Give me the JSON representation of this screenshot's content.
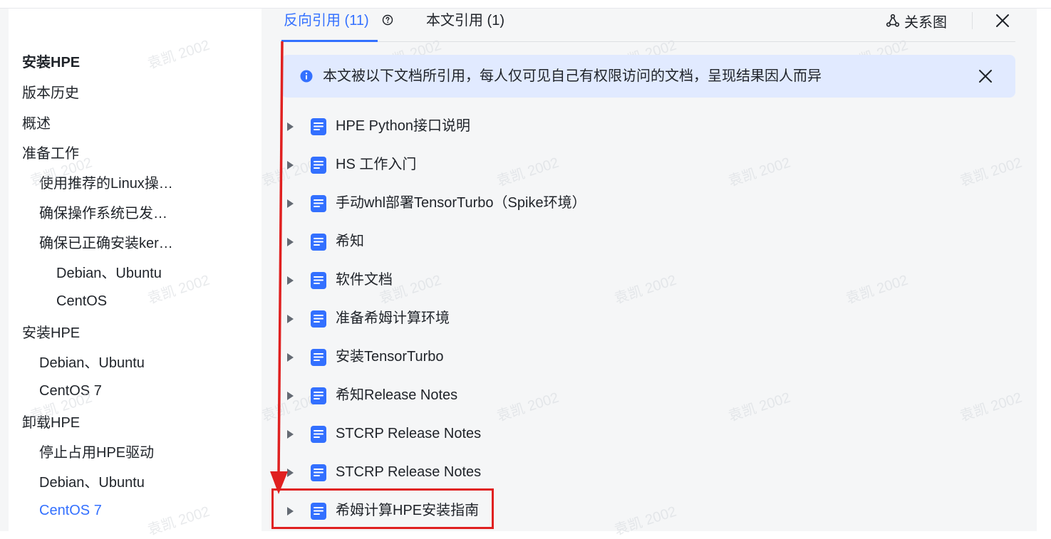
{
  "toc": {
    "items": [
      {
        "label": "安装HPE",
        "level": 0,
        "bold": true
      },
      {
        "label": "版本历史",
        "level": 0
      },
      {
        "label": "概述",
        "level": 0
      },
      {
        "label": "准备工作",
        "level": 0
      },
      {
        "label": "使用推荐的Linux操…",
        "level": 1
      },
      {
        "label": "确保操作系统已发…",
        "level": 1
      },
      {
        "label": "确保已正确安装ker…",
        "level": 1
      },
      {
        "label": "Debian、Ubuntu",
        "level": 2
      },
      {
        "label": "CentOS",
        "level": 2
      },
      {
        "label": "安装HPE",
        "level": 0
      },
      {
        "label": "Debian、Ubuntu",
        "level": 1
      },
      {
        "label": "CentOS 7",
        "level": 1
      },
      {
        "label": "卸载HPE",
        "level": 0
      },
      {
        "label": "停止占用HPE驱动",
        "level": 1
      },
      {
        "label": "Debian、Ubuntu",
        "level": 1
      },
      {
        "label": "CentOS 7",
        "level": 1,
        "active": true
      }
    ]
  },
  "panel": {
    "tabs": [
      {
        "label": "反向引用 (11)",
        "active": true
      },
      {
        "label": "本文引用 (1)",
        "active": false
      }
    ],
    "graph_label": "关系图",
    "banner_text": "本文被以下文档所引用，每人仅可见自己有权限访问的文档，呈现结果因人而异",
    "docs": [
      {
        "title": "HPE Python接口说明"
      },
      {
        "title": "HS 工作入门"
      },
      {
        "title": "手动whl部署TensorTurbo（Spike环境）"
      },
      {
        "title": "希知"
      },
      {
        "title": "软件文档"
      },
      {
        "title": "准备希姆计算环境"
      },
      {
        "title": "安装TensorTurbo"
      },
      {
        "title": "希知Release Notes"
      },
      {
        "title": "STCRP Release Notes"
      },
      {
        "title": "STCRP Release Notes"
      },
      {
        "title": "希姆计算HPE安装指南",
        "highlighted": true
      }
    ]
  },
  "watermark_text": "袁凯 2002",
  "colors": {
    "accent": "#3370ff",
    "banner_bg": "#e1eaff",
    "panel_bg": "#f5f6f7",
    "annotation_red": "#e02020"
  }
}
